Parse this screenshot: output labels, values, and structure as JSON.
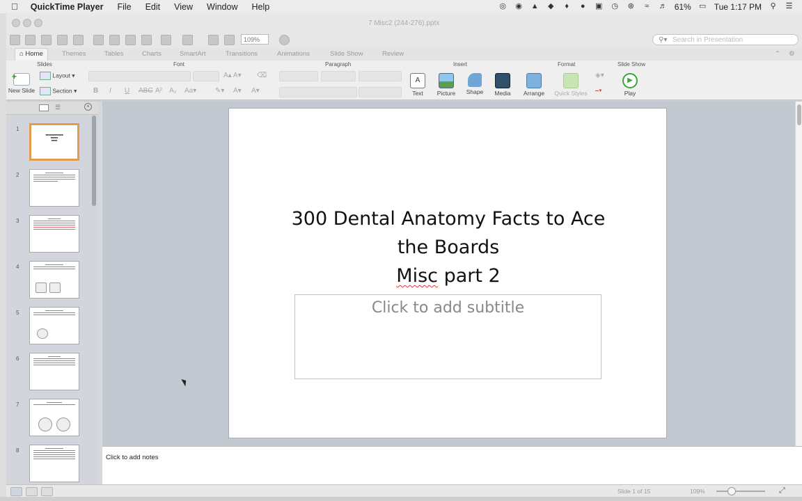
{
  "menubar": {
    "app_name": "QuickTime Player",
    "menus": [
      "File",
      "Edit",
      "View",
      "Window",
      "Help"
    ],
    "battery": "61%",
    "clock": "Tue 1:17 PM"
  },
  "window": {
    "doc_title": "7 Misc2 (244-276).pptx"
  },
  "toolbar": {
    "zoom": "109%",
    "search_placeholder": "Search in Presentation"
  },
  "ribbon": {
    "tabs": [
      "Home",
      "Themes",
      "Tables",
      "Charts",
      "SmartArt",
      "Transitions",
      "Animations",
      "Slide Show",
      "Review"
    ],
    "groups": [
      "Slides",
      "Font",
      "Paragraph",
      "Insert",
      "Format",
      "Slide Show"
    ],
    "slides_group": {
      "new_slide": "New Slide",
      "layout": "Layout",
      "section": "Section"
    },
    "insert_group": [
      "Text",
      "Picture",
      "Shape",
      "Media"
    ],
    "format_group": [
      "Arrange",
      "Quick Styles"
    ],
    "slideshow_group": {
      "play": "Play"
    }
  },
  "slides_pane": {
    "numbers": [
      "1",
      "2",
      "3",
      "4",
      "5",
      "6",
      "7",
      "8"
    ]
  },
  "slide": {
    "title_line1": "300 Dental Anatomy Facts to Ace",
    "title_line2": "the Boards",
    "title_line3_a": "Misc",
    "title_line3_b": " part 2",
    "subtitle_placeholder": "Click to add subtitle"
  },
  "notes": {
    "placeholder": "Click to add notes"
  },
  "status": {
    "slide_counter": "Slide 1 of 15",
    "zoom": "109%"
  },
  "colors": {
    "accent_selected_thumb": "#e29c4e",
    "play_green": "#3aa53a"
  }
}
